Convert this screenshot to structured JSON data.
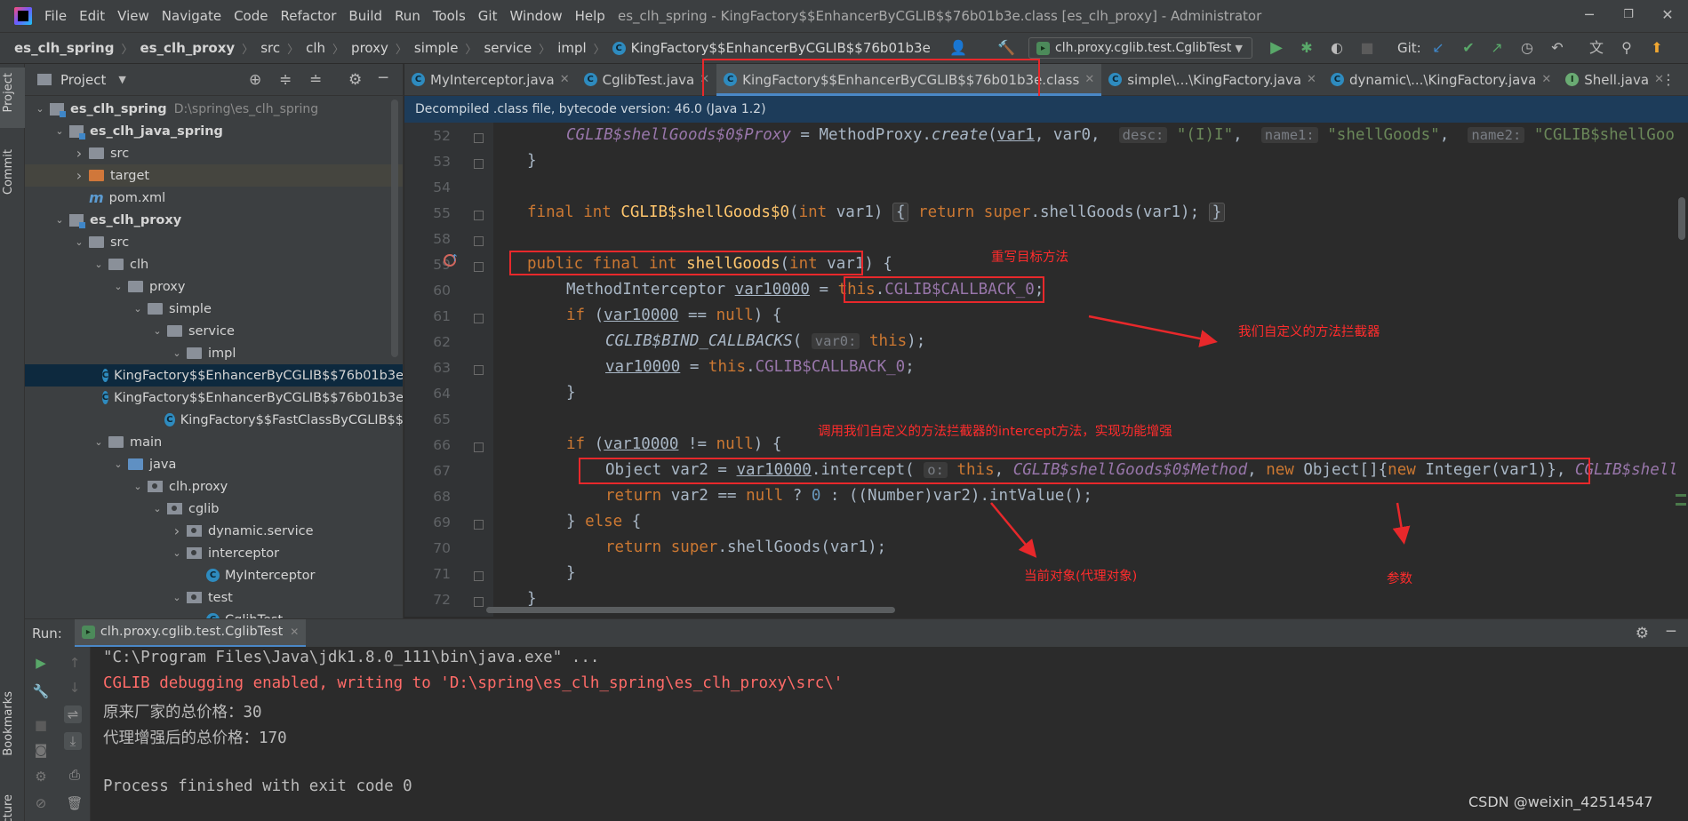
{
  "menu": [
    "File",
    "Edit",
    "View",
    "Navigate",
    "Code",
    "Refactor",
    "Build",
    "Run",
    "Tools",
    "Git",
    "Window",
    "Help"
  ],
  "window_title": "es_clh_spring - KingFactory$$EnhancerByCGLIB$$76b01b3e.class [es_clh_proxy] - Administrator",
  "breadcrumbs": [
    "es_clh_spring",
    "es_clh_proxy",
    "src",
    "clh",
    "proxy",
    "simple",
    "service",
    "impl",
    "KingFactory$$EnhancerByCGLIB$$76b01b3e"
  ],
  "run_config": "clh.proxy.cglib.test.CglibTest",
  "git_label": "Git:",
  "side_tabs": {
    "project": "Project",
    "commit": "Commit",
    "bookmarks": "Bookmarks",
    "structure": "ucture"
  },
  "project": {
    "title": "Project",
    "tree": [
      {
        "label": "es_clh_spring",
        "path": "D:\\spring\\es_clh_spring",
        "depth": 0,
        "arrow": "down",
        "icon": "module",
        "bold": true
      },
      {
        "label": "es_clh_java_spring",
        "depth": 1,
        "arrow": "down",
        "icon": "module",
        "bold": true
      },
      {
        "label": "src",
        "depth": 2,
        "arrow": "right",
        "icon": "folder"
      },
      {
        "label": "target",
        "depth": 2,
        "arrow": "right",
        "icon": "folder-orange",
        "hl": true
      },
      {
        "label": "pom.xml",
        "depth": 2,
        "arrow": "",
        "icon": "maven"
      },
      {
        "label": "es_clh_proxy",
        "depth": 1,
        "arrow": "down",
        "icon": "module",
        "bold": true
      },
      {
        "label": "src",
        "depth": 2,
        "arrow": "down",
        "icon": "folder"
      },
      {
        "label": "clh",
        "depth": 3,
        "arrow": "down",
        "icon": "folder"
      },
      {
        "label": "proxy",
        "depth": 4,
        "arrow": "down",
        "icon": "folder"
      },
      {
        "label": "simple",
        "depth": 5,
        "arrow": "down",
        "icon": "folder"
      },
      {
        "label": "service",
        "depth": 6,
        "arrow": "down",
        "icon": "folder"
      },
      {
        "label": "impl",
        "depth": 7,
        "arrow": "down",
        "icon": "folder"
      },
      {
        "label": "KingFactory$$EnhancerByCGLIB$$76b01b3e",
        "depth": 8,
        "arrow": "",
        "icon": "class",
        "sel": true
      },
      {
        "label": "KingFactory$$EnhancerByCGLIB$$76b01b3e",
        "depth": 8,
        "arrow": "",
        "icon": "class"
      },
      {
        "label": "KingFactory$$FastClassByCGLIB$$",
        "depth": 8,
        "arrow": "",
        "icon": "class"
      },
      {
        "label": "main",
        "depth": 3,
        "arrow": "down",
        "icon": "folder"
      },
      {
        "label": "java",
        "depth": 4,
        "arrow": "down",
        "icon": "folder-blue"
      },
      {
        "label": "clh.proxy",
        "depth": 5,
        "arrow": "down",
        "icon": "package"
      },
      {
        "label": "cglib",
        "depth": 6,
        "arrow": "down",
        "icon": "package"
      },
      {
        "label": "dynamic.service",
        "depth": 7,
        "arrow": "right",
        "icon": "package"
      },
      {
        "label": "interceptor",
        "depth": 7,
        "arrow": "down",
        "icon": "package"
      },
      {
        "label": "MyInterceptor",
        "depth": 8,
        "arrow": "",
        "icon": "class"
      },
      {
        "label": "test",
        "depth": 7,
        "arrow": "down",
        "icon": "package"
      },
      {
        "label": "CglibTest",
        "depth": 8,
        "arrow": "",
        "icon": "class"
      }
    ]
  },
  "tabs": [
    {
      "label": "MyInterceptor.java",
      "icon": "class"
    },
    {
      "label": "CglibTest.java",
      "icon": "class"
    },
    {
      "label": "KingFactory$$EnhancerByCGLIB$$76b01b3e.class",
      "icon": "class",
      "active": true
    },
    {
      "label": "simple\\...\\KingFactory.java",
      "icon": "class"
    },
    {
      "label": "dynamic\\...\\KingFactory.java",
      "icon": "class"
    },
    {
      "label": "Shell.java",
      "icon": "interface"
    }
  ],
  "info_bar": "Decompiled .class file, bytecode version: 46.0 (Java 1.2)",
  "line_numbers": [
    "52",
    "53",
    "54",
    "55",
    "58",
    "59",
    "60",
    "61",
    "62",
    "63",
    "64",
    "65",
    "66",
    "67",
    "68",
    "69",
    "70",
    "71",
    "72"
  ],
  "annotations": {
    "override": "重写目标方法",
    "interceptor": "我们自定义的方法拦截器",
    "call_intercept": "调用我们自定义的方法拦截器的intercept方法，实现功能增强",
    "current_obj": "当前对象(代理对象)",
    "params": "参数"
  },
  "run": {
    "label": "Run:",
    "tab": "clh.proxy.cglib.test.CglibTest",
    "lines": [
      "\"C:\\Program Files\\Java\\jdk1.8.0_111\\bin\\java.exe\" ...",
      "CGLIB debugging enabled, writing to 'D:\\spring\\es_clh_spring\\es_clh_proxy\\src\\'",
      "原来厂家的总价格：30",
      "代理增强后的总价格：170",
      "",
      "Process finished with exit code 0"
    ]
  },
  "watermark": "CSDN @weixin_42514547",
  "colors": {
    "keyword": "#cc7832",
    "function": "#ffc66d",
    "field": "#9876aa",
    "string": "#6a8759",
    "annotation": "#ff2c2c",
    "error": "#ff6b68"
  }
}
